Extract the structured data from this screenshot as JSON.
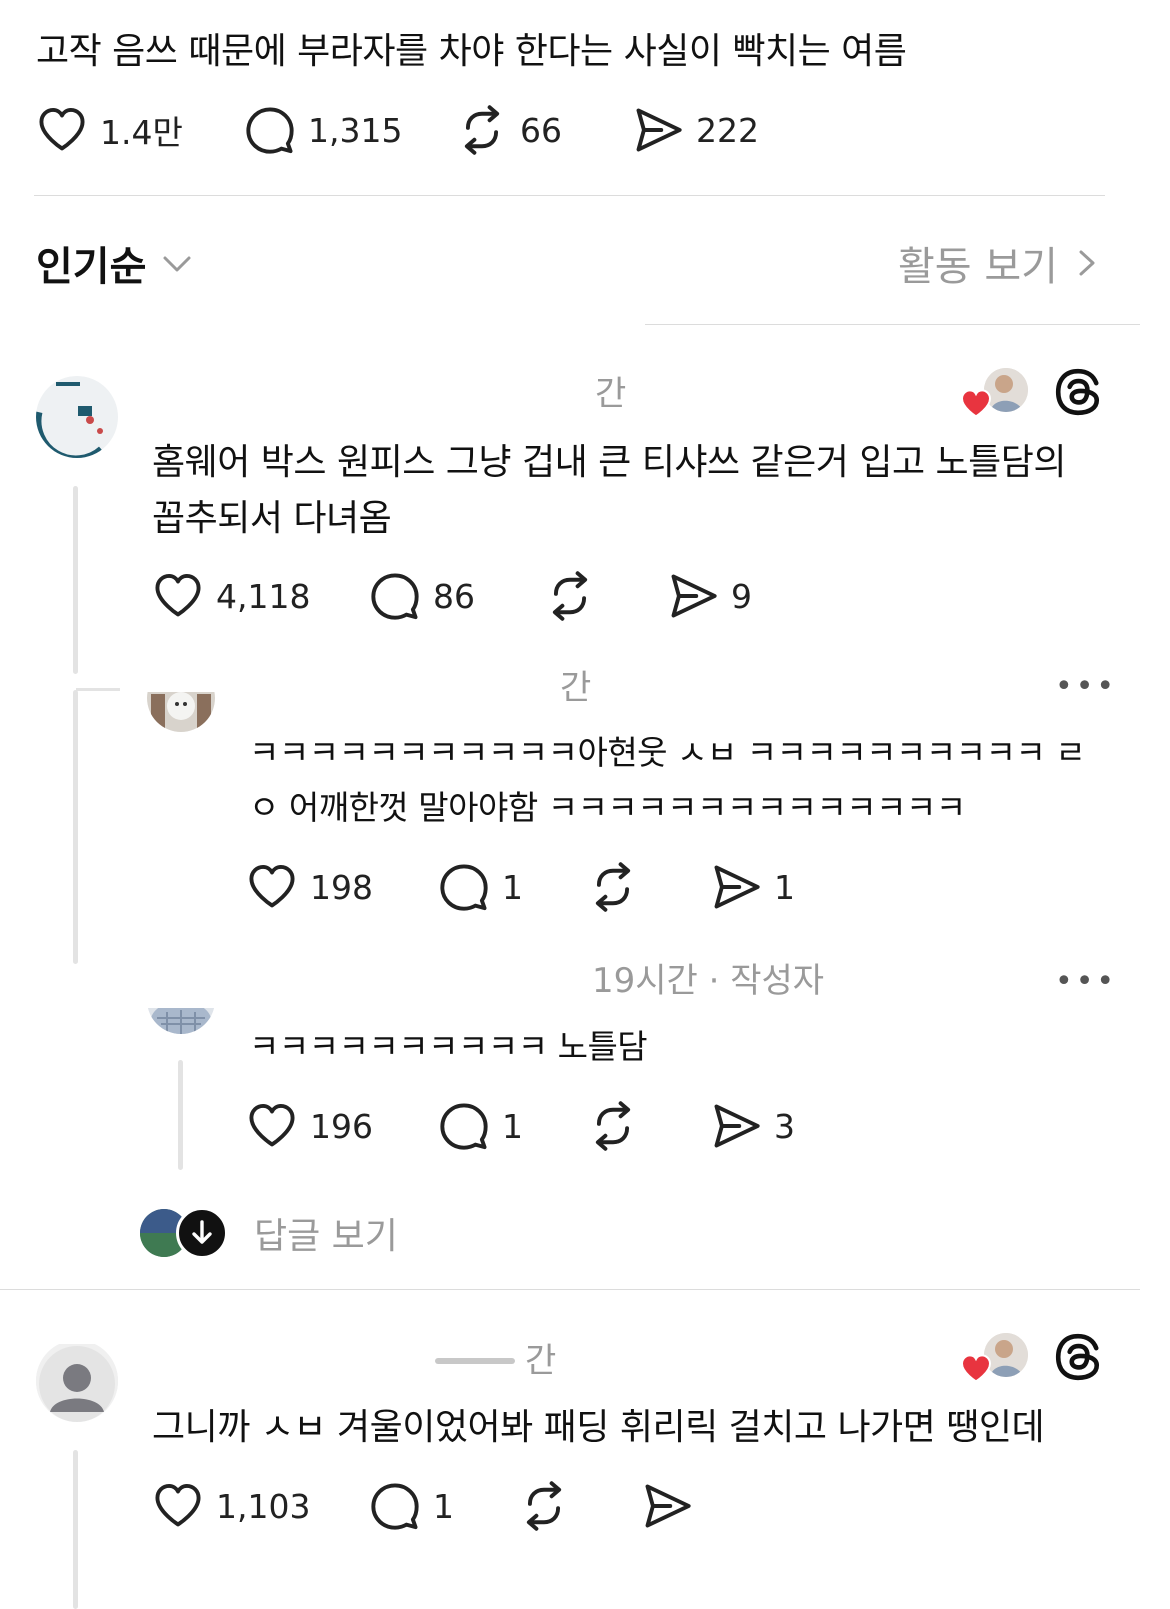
{
  "post": {
    "text": "고작 음쓰 때문에 부라자를 차야 한다는 사실이 빡치는 여름",
    "likes": "1.4만",
    "comments": "1,315",
    "reposts": "66",
    "shares": "222"
  },
  "sort": {
    "label": "인기순",
    "activity_label": "활동 보기"
  },
  "replies": [
    {
      "time": "간",
      "text_line1": "홈웨어 박스 원피스 그냥 겁내 큰 티샤쓰 같은거 입고 노틀담의",
      "text_line2": "꼽추되서 다녀옴",
      "likes": "4,118",
      "comments": "86",
      "shares": "9"
    },
    {
      "time": "간",
      "text_line1": "ㅋㅋㅋㅋㅋㅋㅋㅋㅋㅋㅋ아현웃 ㅅㅂ ㅋㅋㅋㅋㅋㅋㅋㅋㅋㅋ ㄹ",
      "text_line2": "ㅇ 어깨한껏 말아야함 ㅋㅋㅋㅋㅋㅋㅋㅋㅋㅋㅋㅋㅋㅋ",
      "likes": "198",
      "comments": "1",
      "shares": "1"
    },
    {
      "time": "19시간 · 작성자",
      "text_line1": "ㅋㅋㅋㅋㅋㅋㅋㅋㅋㅋ 노틀담",
      "likes": "196",
      "comments": "1",
      "shares": "3"
    },
    {
      "time": "간",
      "text_line1": "그니까 ㅅㅂ 겨울이었어봐 패딩 휘리릭 걸치고 나가면 땡인데",
      "likes": "1,103",
      "comments": "1"
    }
  ],
  "view_replies_label": "답글 보기",
  "icons": {
    "like": "heart-icon",
    "comment": "speech-bubble-icon",
    "repost": "repost-arrows-icon",
    "share": "paper-plane-icon",
    "threads": "threads-logo-icon",
    "more": "more-dots-icon",
    "chevron_down": "chevron-down-icon",
    "chevron_right": "chevron-right-icon",
    "arrow_down": "arrow-down-icon"
  },
  "colors": {
    "text": "#111111",
    "muted": "#9a9a9a",
    "heart_red": "#e8343f",
    "divider": "#dcdcdc"
  }
}
